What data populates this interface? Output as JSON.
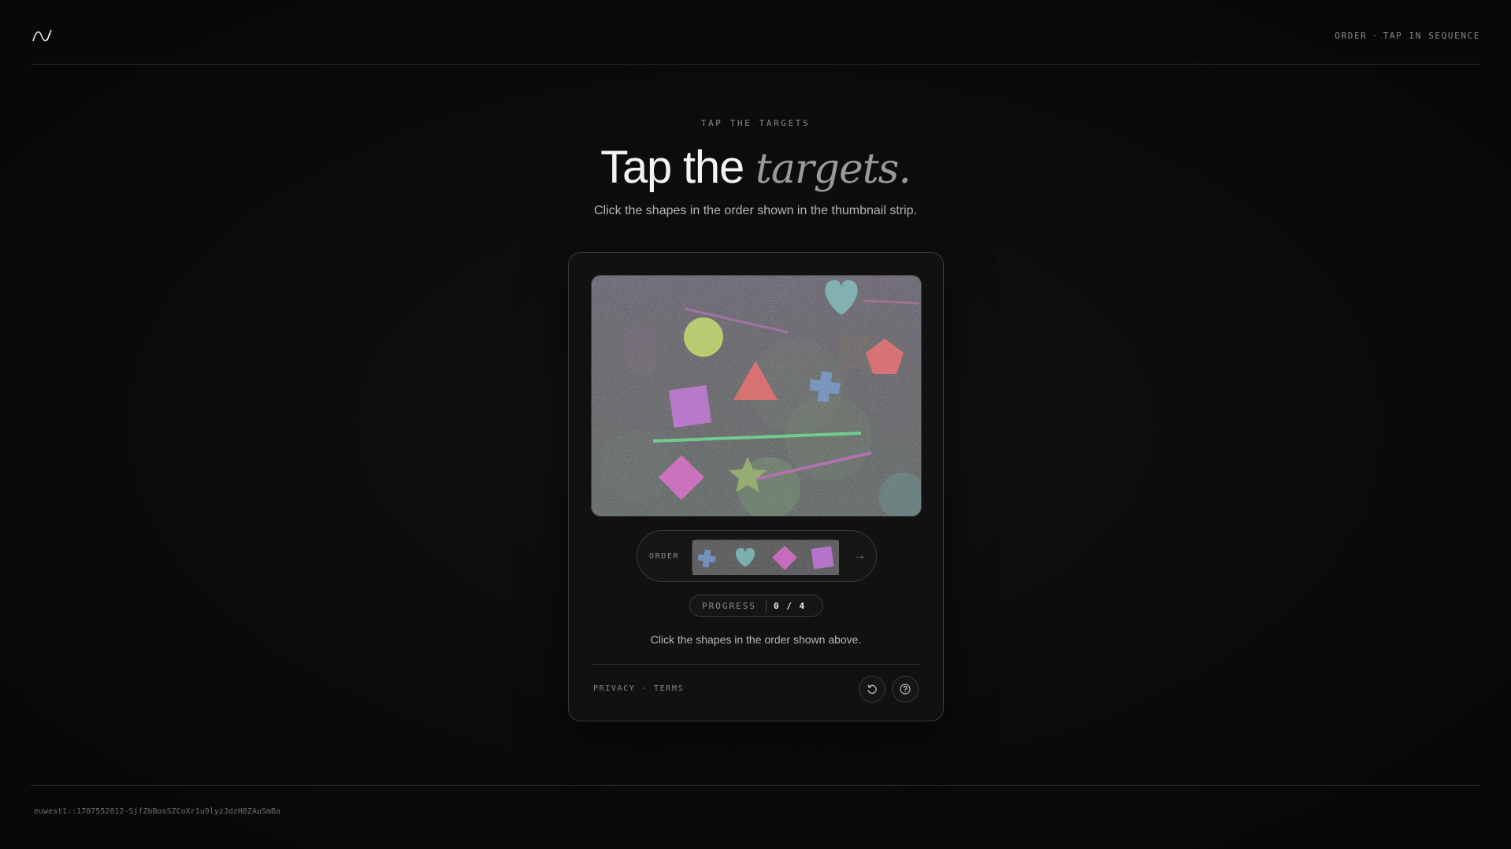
{
  "header": {
    "logo_icon": "waveform-logo-icon",
    "mode_label": "ORDER",
    "mode_separator": "·",
    "mode_detail": "TAP IN SEQUENCE"
  },
  "hero": {
    "eyebrow": "TAP THE TARGETS",
    "title_plain": "Tap the ",
    "title_emphasis": "targets.",
    "subtitle": "Click the shapes in the order shown in the thumbnail strip."
  },
  "challenge": {
    "canvas_shapes": [
      "circle",
      "triangle",
      "cross",
      "square",
      "pentagon",
      "heart",
      "diamond",
      "star"
    ],
    "order_label": "ORDER",
    "order_sequence": [
      "cross",
      "heart",
      "diamond",
      "square"
    ],
    "next_icon": "arrow-right-icon",
    "progress_label": "PROGRESS",
    "progress_value": "0 / 4",
    "progress_current": 0,
    "progress_total": 4,
    "hint": "Click the shapes in the order shown above."
  },
  "card_footer": {
    "privacy_label": "PRIVACY",
    "separator": "·",
    "terms_label": "TERMS",
    "reload_icon": "reload-icon",
    "help_icon": "help-icon"
  },
  "footer": {
    "session_id": "euwest1::1787552812-SjfZbBosSZCoXr1u9lyzJdzH8ZAuSmBa"
  },
  "colors": {
    "background": "#0b0b0b",
    "card": "#111111",
    "border": "#3a3a3a",
    "muted_text": "#8a8a8a"
  }
}
